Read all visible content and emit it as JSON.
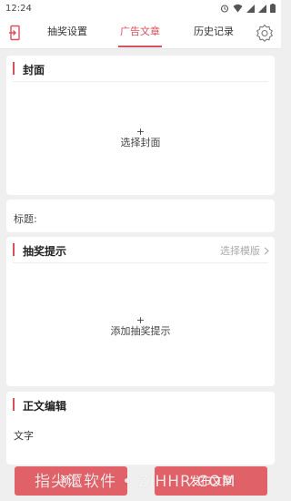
{
  "status_bar": {
    "time": "12:24",
    "icons": [
      "alarm-icon",
      "wifi-icon",
      "signal-icon",
      "signal-icon",
      "battery-icon"
    ]
  },
  "nav": {
    "back_icon": "book-exit-icon",
    "tabs": [
      {
        "label": "抽奖设置",
        "active": false
      },
      {
        "label": "广告文章",
        "active": true
      },
      {
        "label": "历史记录",
        "active": false
      }
    ],
    "settings_icon": "gear-icon"
  },
  "cover": {
    "title": "封面",
    "plus": "+",
    "action": "选择封面"
  },
  "title_field": {
    "label": "标题:"
  },
  "prompt": {
    "title": "抽奖提示",
    "template_link": "选择模版",
    "plus": "+",
    "action": "添加抽奖提示"
  },
  "body_editor": {
    "title": "正文编辑",
    "text_label": "文字"
  },
  "buttons": {
    "preview": "预览",
    "publish": "发布文章"
  },
  "watermark": "指尖汇软件 • ZIHHR.COM",
  "colors": {
    "accent": "#d9505a",
    "button": "#e06168",
    "background": "#efefef"
  }
}
